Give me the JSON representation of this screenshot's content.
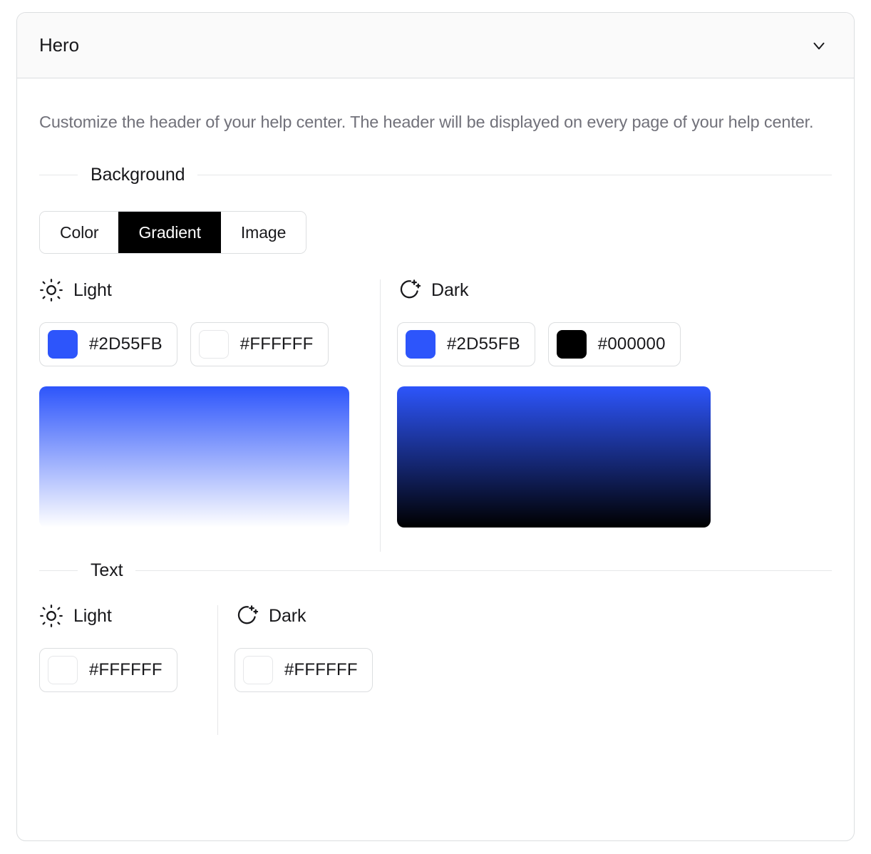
{
  "card": {
    "title": "Hero",
    "collapse_icon": "chevron-down-icon",
    "description": "Customize the header of your help center. The header will be displayed on every page of your help center."
  },
  "background_section": {
    "label": "Background",
    "segmented_control": {
      "options": [
        "Color",
        "Gradient",
        "Image"
      ],
      "selected": "Gradient"
    },
    "light": {
      "icon": "sun-icon",
      "label": "Light",
      "colors": [
        {
          "hex": "#2D55FB",
          "swatch": "#2D55FB"
        },
        {
          "hex": "#FFFFFF",
          "swatch": "#FFFFFF"
        }
      ],
      "preview_gradient": {
        "from": "#2D55FB",
        "to": "#FFFFFF"
      }
    },
    "dark": {
      "icon": "moon-stars-icon",
      "label": "Dark",
      "colors": [
        {
          "hex": "#2D55FB",
          "swatch": "#2D55FB"
        },
        {
          "hex": "#000000",
          "swatch": "#000000"
        }
      ],
      "preview_gradient": {
        "from": "#2D55FB",
        "to": "#000000"
      }
    }
  },
  "text_section": {
    "label": "Text",
    "light": {
      "icon": "sun-icon",
      "label": "Light",
      "colors": [
        {
          "hex": "#FFFFFF",
          "swatch": "#FFFFFF"
        }
      ]
    },
    "dark": {
      "icon": "moon-stars-icon",
      "label": "Dark",
      "colors": [
        {
          "hex": "#FFFFFF",
          "swatch": "#FFFFFF"
        }
      ]
    }
  }
}
